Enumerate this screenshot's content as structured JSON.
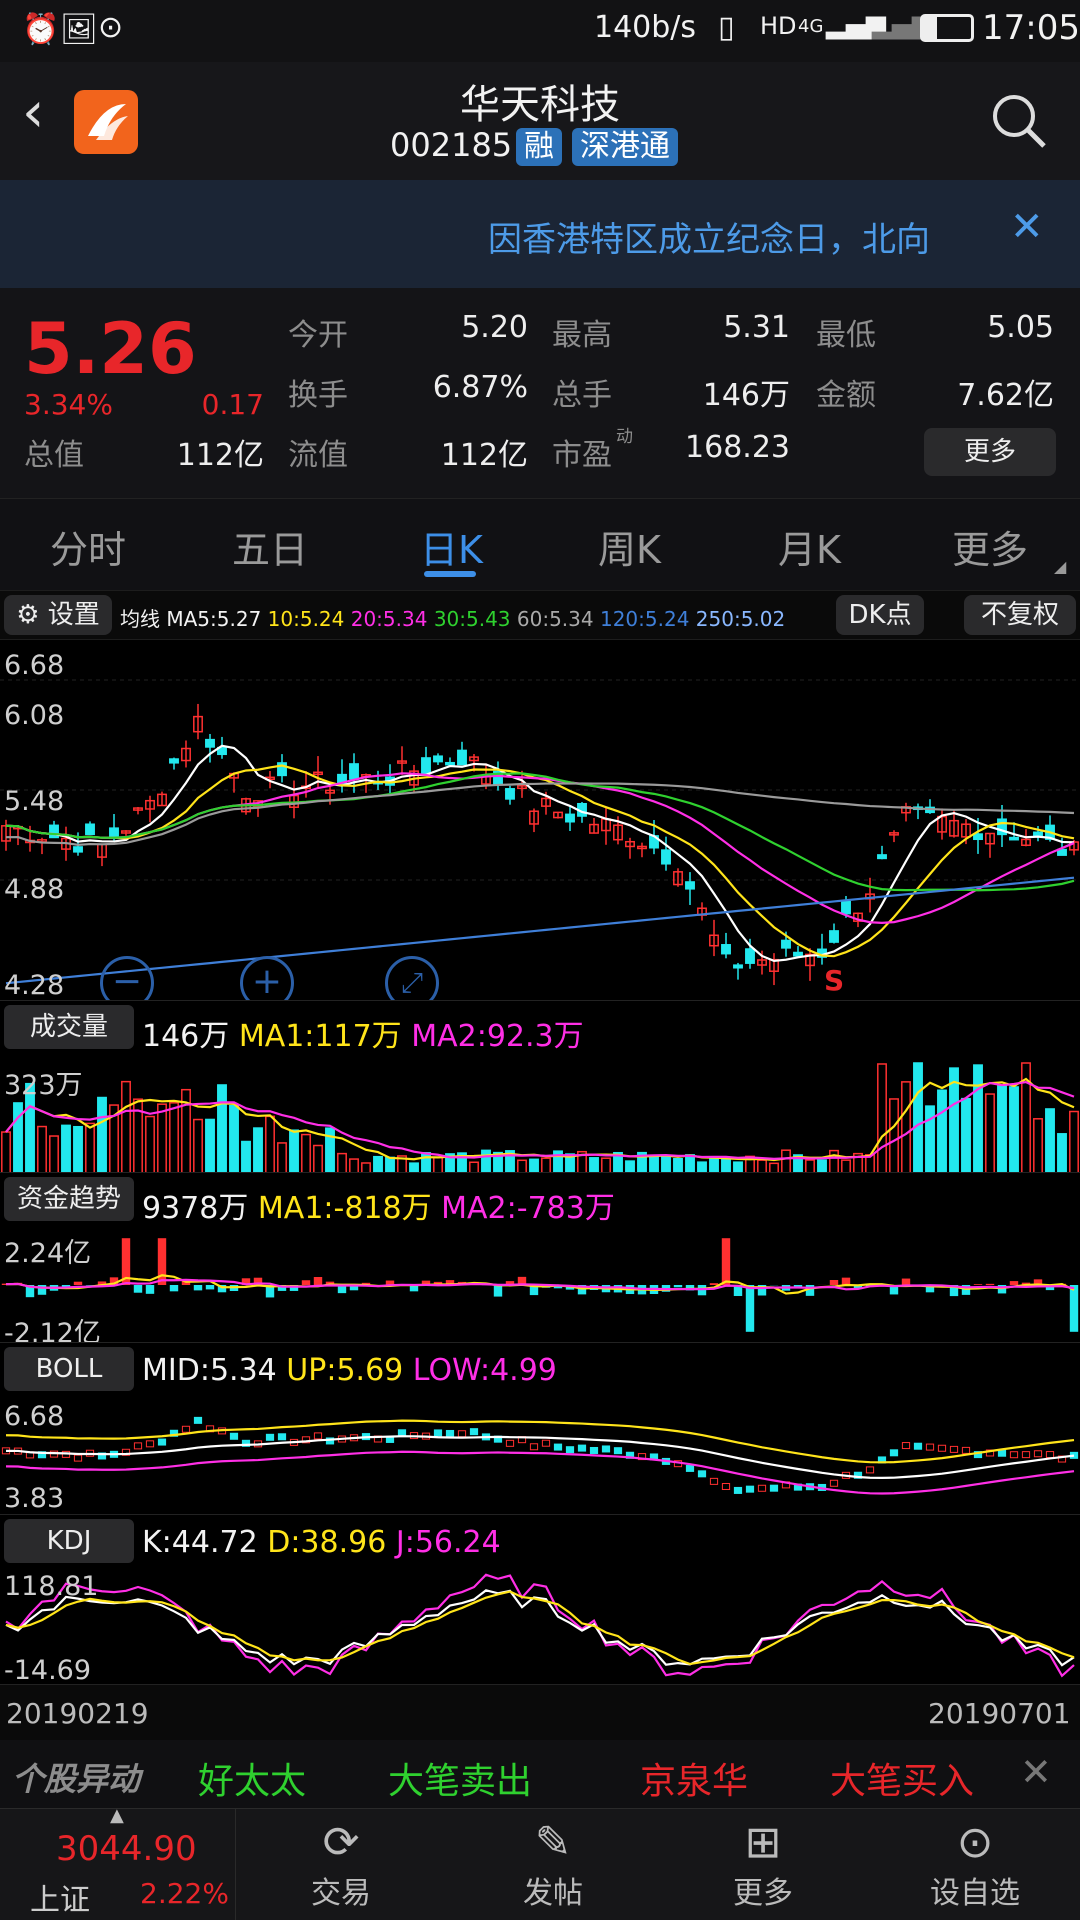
{
  "status": {
    "speed": "140b/s",
    "network": "4G",
    "time": "17:05"
  },
  "header": {
    "title": "华天科技",
    "code": "002185",
    "badges": [
      "融",
      "深港通"
    ]
  },
  "banner": {
    "text": "因香港特区成立纪念日，北向"
  },
  "quote": {
    "price": "5.26",
    "change_pct": "3.34%",
    "change": "0.17",
    "total_value_label": "总值",
    "total_value": "112亿",
    "open_label": "今开",
    "open": "5.20",
    "high_label": "最高",
    "high": "5.31",
    "low_label": "最低",
    "low": "5.05",
    "turnover_label": "换手",
    "turnover": "6.87%",
    "volume_label": "总手",
    "volume": "146万",
    "amount_label": "金额",
    "amount": "7.62亿",
    "float_label": "流值",
    "float_value": "112亿",
    "pe_label": "市盈",
    "pe_sup": "动",
    "pe": "168.23",
    "more_button": "更多"
  },
  "tabs": [
    "分时",
    "五日",
    "日K",
    "周K",
    "月K",
    "更多"
  ],
  "active_tab": 2,
  "ma_bar": {
    "settings": "设置",
    "label": "均线",
    "ma5": "MA5:5.27",
    "ma10": "10:5.24",
    "ma20": "20:5.34",
    "ma30": "30:5.43",
    "ma60": "60:5.34",
    "ma120": "120:5.24",
    "ma250": "250:5.02",
    "dk_button": "DK点",
    "restore_button": "不复权"
  },
  "kline": {
    "y_labels": [
      "6.68",
      "6.08",
      "5.48",
      "4.88",
      "4.28"
    ],
    "signal": "S"
  },
  "volume": {
    "tag": "成交量",
    "value": "146万",
    "ma1": "MA1:117万",
    "ma2": "MA2:92.3万",
    "max": "323万"
  },
  "fund": {
    "tag": "资金趋势",
    "value": "9378万",
    "ma1": "MA1:-818万",
    "ma2": "MA2:-783万",
    "max": "2.24亿",
    "min": "-2.12亿"
  },
  "boll": {
    "tag": "BOLL",
    "mid": "MID:5.34",
    "up": "UP:5.69",
    "low": "LOW:4.99",
    "max": "6.68",
    "min": "3.83"
  },
  "kdj": {
    "tag": "KDJ",
    "k": "K:44.72",
    "d": "D:38.96",
    "j": "J:56.24",
    "max": "118.81",
    "min": "-14.69"
  },
  "dates": {
    "start": "20190219",
    "end": "20190701"
  },
  "alerts": {
    "title": "个股异动",
    "items": [
      "好太太",
      "大笔卖出",
      "京泉华",
      "大笔买入"
    ]
  },
  "bottom": {
    "index_value": "3044.90",
    "index_name": "上证",
    "index_change": "2.22%",
    "nav": [
      "交易",
      "发帖",
      "更多",
      "设自选"
    ]
  }
}
